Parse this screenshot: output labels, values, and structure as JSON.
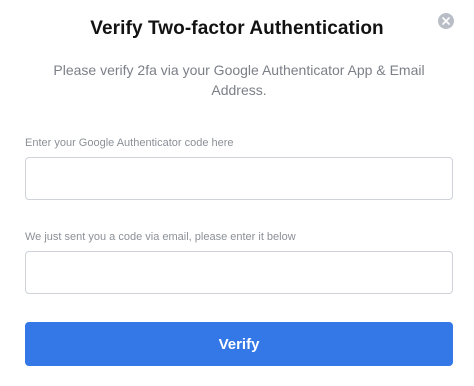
{
  "dialog": {
    "title": "Verify Two-factor Authentication",
    "subtitle": "Please verify 2fa via your Google Authenticator App & Email Address.",
    "close_icon": "close-icon"
  },
  "fields": [
    {
      "label": "Enter your Google Authenticator code here",
      "value": "",
      "placeholder": ""
    },
    {
      "label": "We just sent you a code via email, please enter it below",
      "value": "",
      "placeholder": ""
    }
  ],
  "actions": {
    "verify_label": "Verify"
  },
  "colors": {
    "primary": "#3478e8",
    "close_icon_bg": "#b9bec6",
    "input_border": "#cfd3d9",
    "label_text": "#8b9097",
    "subtitle_text": "#7b7f87"
  }
}
